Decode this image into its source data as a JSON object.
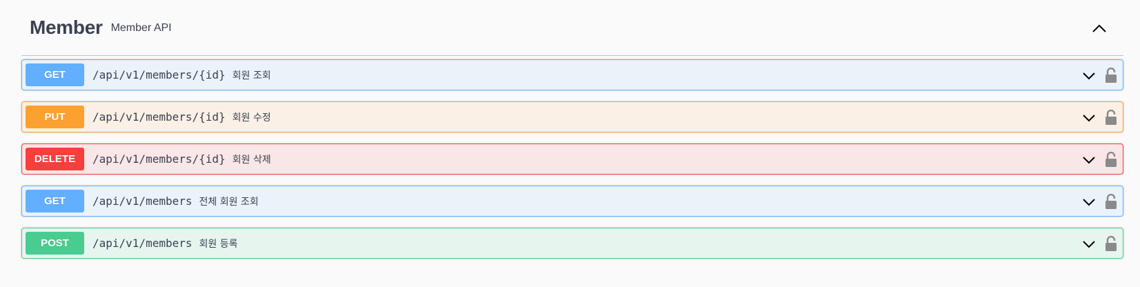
{
  "tag": {
    "title": "Member",
    "description": "Member API"
  },
  "operations": [
    {
      "method": "GET",
      "path": "/api/v1/members/{id}",
      "summary": "회원 조회"
    },
    {
      "method": "PUT",
      "path": "/api/v1/members/{id}",
      "summary": "회원 수정"
    },
    {
      "method": "DELETE",
      "path": "/api/v1/members/{id}",
      "summary": "회원 삭제"
    },
    {
      "method": "GET",
      "path": "/api/v1/members",
      "summary": "전체 회원 조회"
    },
    {
      "method": "POST",
      "path": "/api/v1/members",
      "summary": "회원 등록"
    }
  ],
  "icons": {
    "collapse": "chevron-up-icon",
    "expand": "chevron-down-icon",
    "lock": "lock-icon"
  },
  "colors": {
    "get": "#61affe",
    "put": "#fca130",
    "delete": "#f93e3e",
    "post": "#49cc90",
    "text": "#3b4151"
  }
}
